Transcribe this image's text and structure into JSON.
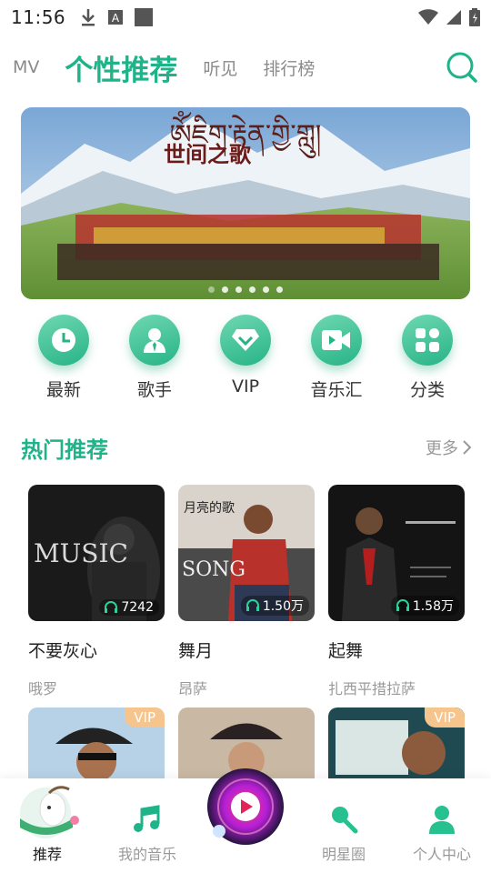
{
  "status_bar": {
    "time": "11:56"
  },
  "top_nav": {
    "tabs": [
      {
        "label": "MV"
      },
      {
        "label": "个性推荐"
      },
      {
        "label": "听见"
      },
      {
        "label": "排行榜"
      }
    ]
  },
  "banner": {
    "title_tibetan": "ༀཇིག་རྟེན་གྱི་གླུ།",
    "title_chinese": "世间之歌",
    "dots": 6
  },
  "shortcuts": [
    {
      "label": "最新",
      "icon": "clock-icon"
    },
    {
      "label": "歌手",
      "icon": "singer-icon"
    },
    {
      "label": "VIP",
      "icon": "diamond-icon"
    },
    {
      "label": "音乐汇",
      "icon": "video-icon"
    },
    {
      "label": "分类",
      "icon": "grid-icon"
    }
  ],
  "hot": {
    "title": "热门推荐",
    "more": "更多",
    "cards": [
      {
        "title": "不要灰心",
        "artist": "哦罗",
        "plays": "7242",
        "cover_text": "MUSIC"
      },
      {
        "title": "舞月",
        "artist": "昂萨",
        "plays": "1.50万",
        "cover_text": "月亮的歌"
      },
      {
        "title": "起舞",
        "artist": "扎西平措拉萨",
        "plays": "1.58万",
        "cover_text": ""
      }
    ],
    "row2": [
      {
        "vip": "VIP"
      },
      {
        "vip": ""
      },
      {
        "vip": "VIP"
      }
    ]
  },
  "bottom_nav": {
    "items": [
      {
        "label": "推荐"
      },
      {
        "label": "我的音乐"
      },
      {
        "label": "明星圈"
      },
      {
        "label": "个人中心"
      }
    ]
  },
  "colors": {
    "accent": "#1fb38a",
    "muted": "#999999",
    "vip": "#f6c48d"
  }
}
